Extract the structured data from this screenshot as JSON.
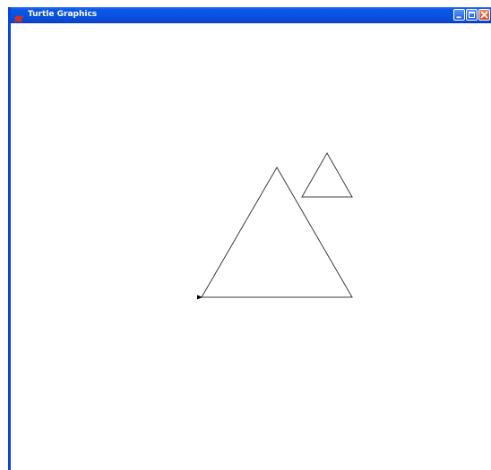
{
  "window": {
    "title": "Turtle Graphics",
    "app_icon": "turtle-app-icon",
    "controls": {
      "minimize_icon": "minimize-icon",
      "maximize_icon": "maximize-icon",
      "close_icon": "close-icon"
    }
  },
  "canvas": {
    "background_color": "#ffffff",
    "stroke_color": "#3c3c3c",
    "cursor_icon": "turtle-arrow-icon",
    "shapes": [
      "large-triangle",
      "small-triangle"
    ]
  }
}
